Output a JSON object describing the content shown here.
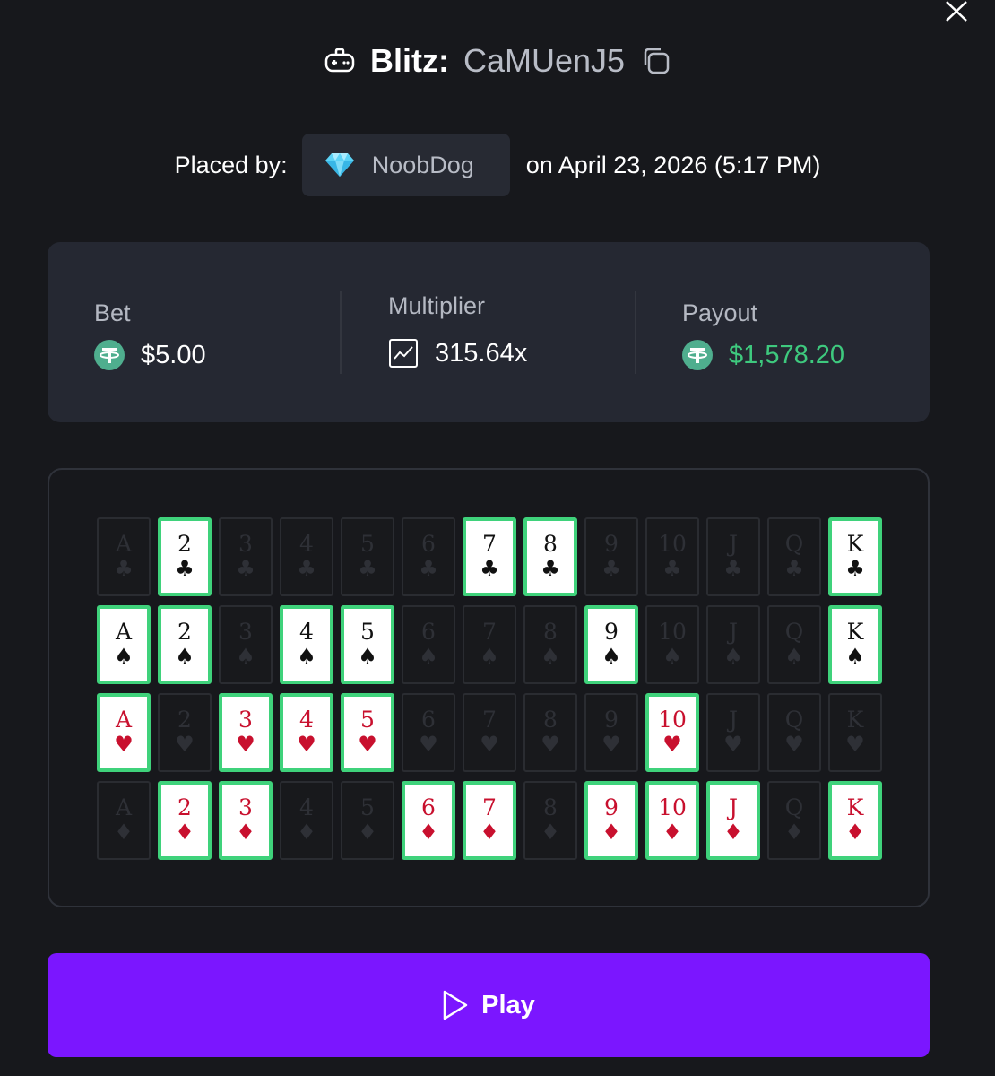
{
  "header": {
    "game_name": "Blitz:",
    "bet_id": "CaMUenJ5"
  },
  "placed": {
    "label": "Placed by:",
    "username": "NoobDog",
    "date": "on April 23, 2026 (5:17 PM)"
  },
  "stats": {
    "bet_label": "Bet",
    "bet_value": "$5.00",
    "multiplier_label": "Multiplier",
    "multiplier_value": "315.64x",
    "payout_label": "Payout",
    "payout_value": "$1,578.20"
  },
  "board": {
    "ranks": [
      "A",
      "2",
      "3",
      "4",
      "5",
      "6",
      "7",
      "8",
      "9",
      "10",
      "J",
      "Q",
      "K"
    ],
    "rows": [
      {
        "suit": "clubs",
        "symbol": "♣",
        "color": "black",
        "active": [
          false,
          true,
          false,
          false,
          false,
          false,
          true,
          true,
          false,
          false,
          false,
          false,
          true
        ]
      },
      {
        "suit": "spades",
        "symbol": "♠",
        "color": "black",
        "active": [
          true,
          true,
          false,
          true,
          true,
          false,
          false,
          false,
          true,
          false,
          false,
          false,
          true
        ]
      },
      {
        "suit": "hearts",
        "symbol": "♥",
        "color": "red",
        "active": [
          true,
          false,
          true,
          true,
          true,
          false,
          false,
          false,
          false,
          true,
          false,
          false,
          false
        ]
      },
      {
        "suit": "diamonds",
        "symbol": "♦",
        "color": "red",
        "active": [
          false,
          true,
          true,
          false,
          false,
          true,
          true,
          false,
          true,
          true,
          true,
          false,
          true
        ]
      }
    ]
  },
  "colors": {
    "accent": "#7b16ff",
    "win_green": "#3ec97e",
    "card_border": "#3fd27b",
    "red_suit": "#c8102e"
  },
  "play_button": {
    "label": "Play"
  }
}
